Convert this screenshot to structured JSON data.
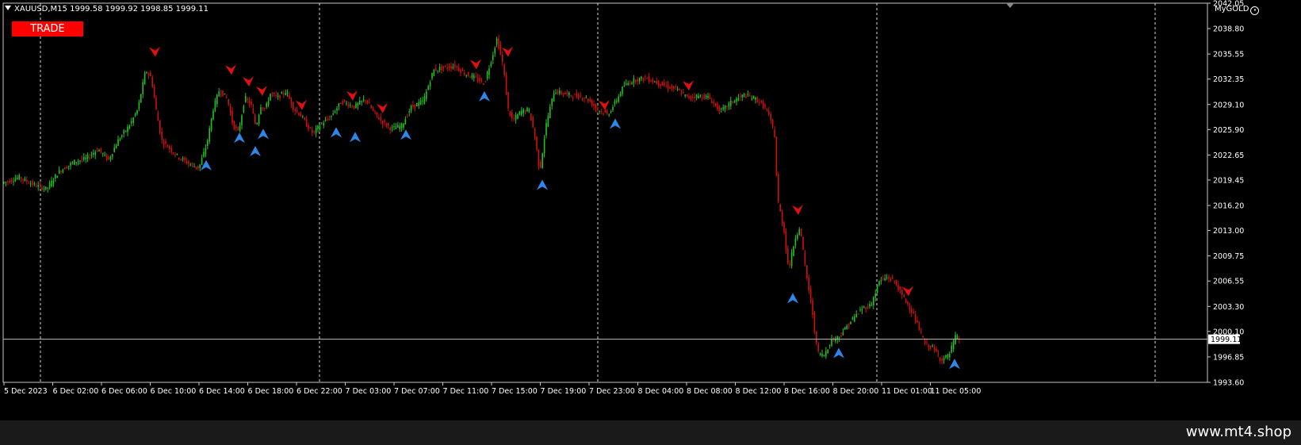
{
  "header": {
    "symbol_info": "XAUUSD,M15  1999.58 1999.92 1998.85 1999.11"
  },
  "trade_button": {
    "label": "TRADE"
  },
  "indicator_label": {
    "text": "MyGOLD",
    "icon": "smiley-icon"
  },
  "watermark": {
    "text": "www.mt4.shop"
  },
  "colors": {
    "background": "#000000",
    "bull": "#22c222",
    "bear": "#d01010",
    "buy_arrow": "#2f86e8",
    "sell_arrow": "#e01010",
    "grid": "#ffffff",
    "trade_button": "#ff0000"
  },
  "chart_data": {
    "type": "candlestick",
    "ylim": [
      1993.6,
      2042.05
    ],
    "current_price": "1999.11",
    "y_ticks": [
      "2042.05",
      "2038.80",
      "2035.55",
      "2032.35",
      "2029.10",
      "2025.90",
      "2022.65",
      "2019.45",
      "2016.20",
      "2013.00",
      "2009.75",
      "2006.55",
      "2003.30",
      "2000.10",
      "1996.85",
      "1993.60"
    ],
    "x_labels": [
      "5 Dec 2023",
      "6 Dec 02:00",
      "6 Dec 06:00",
      "6 Dec 10:00",
      "6 Dec 14:00",
      "6 Dec 18:00",
      "6 Dec 22:00",
      "7 Dec 03:00",
      "7 Dec 07:00",
      "7 Dec 11:00",
      "7 Dec 15:00",
      "7 Dec 19:00",
      "7 Dec 23:00",
      "8 Dec 04:00",
      "8 Dec 08:00",
      "8 Dec 12:00",
      "8 Dec 16:00",
      "8 Dec 20:00",
      "11 Dec 01:00",
      "11 Dec 05:00"
    ],
    "path": [
      [
        0,
        2019.0
      ],
      [
        12,
        2019.3
      ],
      [
        25,
        2019.8
      ],
      [
        45,
        2018.8
      ],
      [
        60,
        2018.3
      ],
      [
        75,
        2020.5
      ],
      [
        95,
        2021.8
      ],
      [
        110,
        2022.2
      ],
      [
        125,
        2023.4
      ],
      [
        138,
        2022.0
      ],
      [
        150,
        2024.5
      ],
      [
        165,
        2026.5
      ],
      [
        175,
        2028.5
      ],
      [
        185,
        2033.5
      ],
      [
        192,
        2032.5
      ],
      [
        198,
        2028.5
      ],
      [
        205,
        2024.5
      ],
      [
        215,
        2023.5
      ],
      [
        225,
        2022.5
      ],
      [
        240,
        2021.5
      ],
      [
        252,
        2021.0
      ],
      [
        262,
        2024.0
      ],
      [
        270,
        2028.5
      ],
      [
        278,
        2031.0
      ],
      [
        288,
        2029.8
      ],
      [
        295,
        2026.5
      ],
      [
        302,
        2025.5
      ],
      [
        310,
        2030.0
      ],
      [
        318,
        2029.0
      ],
      [
        324,
        2026.2
      ],
      [
        330,
        2029.0
      ],
      [
        336,
        2028.5
      ],
      [
        342,
        2030.5
      ],
      [
        352,
        2030.0
      ],
      [
        362,
        2030.8
      ],
      [
        372,
        2028.5
      ],
      [
        380,
        2027.8
      ],
      [
        388,
        2026.5
      ],
      [
        396,
        2025.4
      ],
      [
        405,
        2026.5
      ],
      [
        418,
        2027.5
      ],
      [
        432,
        2029.5
      ],
      [
        448,
        2028.8
      ],
      [
        462,
        2029.8
      ],
      [
        472,
        2028.2
      ],
      [
        482,
        2027.0
      ],
      [
        495,
        2026.0
      ],
      [
        508,
        2026.4
      ],
      [
        520,
        2028.8
      ],
      [
        535,
        2029.5
      ],
      [
        548,
        2033.5
      ],
      [
        560,
        2033.8
      ],
      [
        575,
        2034.0
      ],
      [
        588,
        2033.0
      ],
      [
        600,
        2032.5
      ],
      [
        612,
        2031.8
      ],
      [
        620,
        2034.5
      ],
      [
        628,
        2037.5
      ],
      [
        636,
        2034.0
      ],
      [
        642,
        2028.5
      ],
      [
        648,
        2027.0
      ],
      [
        658,
        2028.2
      ],
      [
        668,
        2028.5
      ],
      [
        675,
        2025.5
      ],
      [
        682,
        2020.5
      ],
      [
        690,
        2026.5
      ],
      [
        700,
        2030.8
      ],
      [
        712,
        2030.5
      ],
      [
        725,
        2030.2
      ],
      [
        740,
        2030.0
      ],
      [
        755,
        2028.5
      ],
      [
        768,
        2027.8
      ],
      [
        778,
        2029.5
      ],
      [
        788,
        2031.5
      ],
      [
        800,
        2032.2
      ],
      [
        815,
        2032.5
      ],
      [
        828,
        2032.0
      ],
      [
        840,
        2031.5
      ],
      [
        855,
        2031.0
      ],
      [
        868,
        2030.0
      ],
      [
        882,
        2030.2
      ],
      [
        895,
        2030.0
      ],
      [
        910,
        2028.2
      ],
      [
        925,
        2029.5
      ],
      [
        940,
        2030.3
      ],
      [
        955,
        2029.8
      ],
      [
        968,
        2028.5
      ],
      [
        978,
        2025.5
      ],
      [
        982,
        2017.0
      ],
      [
        990,
        2013.0
      ],
      [
        996,
        2008.0
      ],
      [
        1004,
        2012.0
      ],
      [
        1010,
        2013.5
      ],
      [
        1018,
        2007.5
      ],
      [
        1026,
        2002.5
      ],
      [
        1032,
        1997.5
      ],
      [
        1040,
        1997.0
      ],
      [
        1050,
        1999.0
      ],
      [
        1060,
        1999.5
      ],
      [
        1075,
        2001.5
      ],
      [
        1088,
        2003.0
      ],
      [
        1100,
        2003.5
      ],
      [
        1110,
        2006.5
      ],
      [
        1120,
        2007.0
      ],
      [
        1130,
        2006.5
      ],
      [
        1140,
        2004.5
      ],
      [
        1150,
        2003.0
      ],
      [
        1160,
        2000.5
      ],
      [
        1168,
        1998.5
      ],
      [
        1178,
        1998.0
      ],
      [
        1188,
        1996.5
      ],
      [
        1198,
        1997.0
      ],
      [
        1206,
        1999.4
      ],
      [
        1212,
        1999.1
      ]
    ],
    "sell_signals": [
      {
        "x": 195,
        "price": 2035.8
      },
      {
        "x": 291,
        "price": 2033.5
      },
      {
        "x": 313,
        "price": 2032.0
      },
      {
        "x": 330,
        "price": 2030.8
      },
      {
        "x": 380,
        "price": 2029.0
      },
      {
        "x": 444,
        "price": 2030.2
      },
      {
        "x": 482,
        "price": 2028.6
      },
      {
        "x": 600,
        "price": 2034.2
      },
      {
        "x": 640,
        "price": 2035.8
      },
      {
        "x": 762,
        "price": 2029.0
      },
      {
        "x": 868,
        "price": 2031.5
      },
      {
        "x": 1006,
        "price": 2015.6
      },
      {
        "x": 1145,
        "price": 2005.2
      }
    ],
    "buy_signals": [
      {
        "x": 260,
        "price": 2021.3
      },
      {
        "x": 302,
        "price": 2024.8
      },
      {
        "x": 322,
        "price": 2023.1
      },
      {
        "x": 332,
        "price": 2025.3
      },
      {
        "x": 424,
        "price": 2025.5
      },
      {
        "x": 448,
        "price": 2024.9
      },
      {
        "x": 512,
        "price": 2025.2
      },
      {
        "x": 611,
        "price": 2030.1
      },
      {
        "x": 684,
        "price": 2018.8
      },
      {
        "x": 776,
        "price": 2026.6
      },
      {
        "x": 1000,
        "price": 2004.3
      },
      {
        "x": 1058,
        "price": 1997.3
      },
      {
        "x": 1204,
        "price": 1995.9
      }
    ]
  }
}
